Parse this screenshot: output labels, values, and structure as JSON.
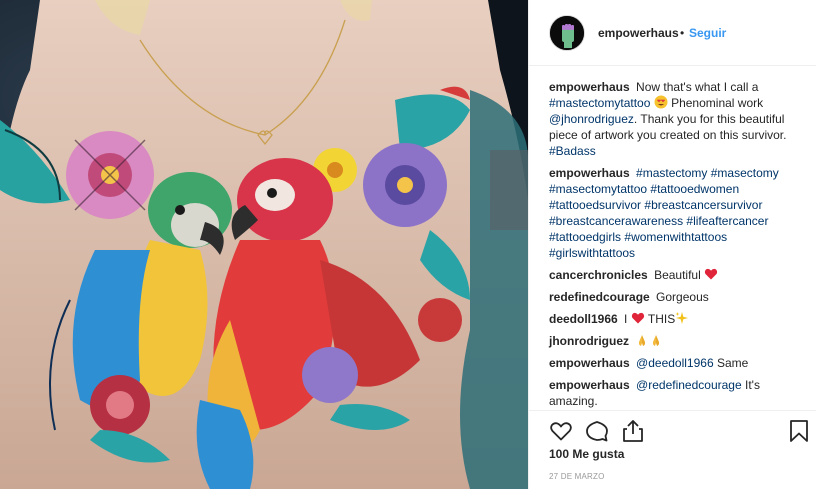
{
  "post": {
    "username": "empowerhaus",
    "follow_separator": "•",
    "follow_label": "Seguir"
  },
  "caption": {
    "username": "empowerhaus",
    "text_1": "Now that's what I call a",
    "tag_1": "#mastectomytattoo",
    "text_2": "Phenominal work",
    "mention": "@jhonrodriguez",
    "text_3": ". Thank you for this beautiful piece of artwork you created on this survivor.",
    "tag_2": "#Badass",
    "emoji_1": "heart-eyes-emoji"
  },
  "comments": [
    {
      "username": "empowerhaus",
      "tags": [
        "#mastectomy",
        "#masectomy",
        "#masectomytattoo",
        "#tattooedwomen",
        "#tattooedsurvivor",
        "#breastcancersurvivor",
        "#breastcancerawareness",
        "#lifeaftercancer",
        "#tattooedgirls",
        "#womenwithtattoos",
        "#girlswithtattoos"
      ]
    },
    {
      "username": "cancerchronicles",
      "text": "Beautiful",
      "emoji": "red-heart-emoji"
    },
    {
      "username": "redefinedcourage",
      "text": "Gorgeous"
    },
    {
      "username": "deedoll1966",
      "text_before": "I",
      "text_after": "THIS",
      "emoji_a": "red-heart-emoji",
      "emoji_b": "sparkles-emoji"
    },
    {
      "username": "jhonrodriguez",
      "emoji": "folded-hands-emoji"
    },
    {
      "username": "empowerhaus",
      "mention": "@deedoll1966",
      "text": "Same"
    },
    {
      "username": "empowerhaus",
      "mention": "@redefinedcourage",
      "text": "It's amazing."
    }
  ],
  "actions": {
    "like_icon": "heart-outline-icon",
    "comment_icon": "comment-bubble-icon",
    "share_icon": "share-icon",
    "save_icon": "bookmark-icon"
  },
  "likes_text": "100 Me gusta",
  "date_text": "27 DE MARZO",
  "colors": {
    "link_blue": "#3897f0",
    "hashtag_navy": "#003569",
    "text": "#262626",
    "muted": "#999999",
    "divider": "#efefef"
  }
}
